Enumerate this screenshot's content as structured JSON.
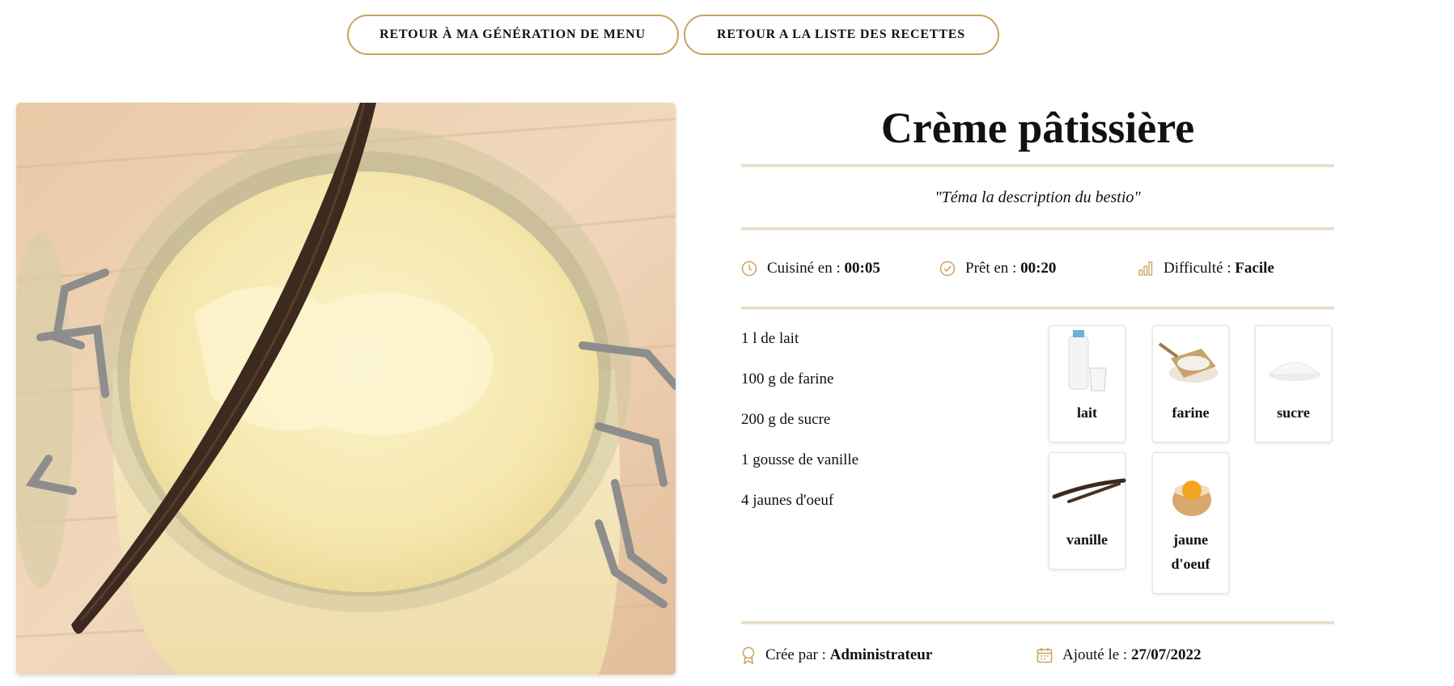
{
  "nav": {
    "back_to_menu": "RETOUR À MA GÉNÉRATION DE MENU",
    "back_to_list": "RETOUR A LA LISTE DES RECETTES"
  },
  "recipe": {
    "title": "Crème pâtissière",
    "description": "\"Téma la description du bestio\"",
    "cook_label": "Cuisiné en :",
    "cook_time": "00:05",
    "ready_label": "Prêt en :",
    "ready_time": "00:20",
    "difficulty_label": "Difficulté :",
    "difficulty": "Facile",
    "ingredients_text": [
      "1 l de lait",
      "100 g de farine",
      "200 g de sucre",
      "1 gousse de vanille",
      "4 jaunes d'oeuf"
    ],
    "ingredient_cards": [
      "lait",
      "farine",
      "sucre",
      "vanille",
      "jaune d'oeuf"
    ],
    "created_by_label": "Crée par :",
    "created_by": "Administrateur",
    "added_label": "Ajouté le :",
    "added_date": "27/07/2022"
  },
  "colors": {
    "accent": "#caa25e",
    "separator": "#e7ddc7"
  },
  "icons": [
    "clock-icon",
    "check-circle-icon",
    "signal-bars-icon",
    "award-icon",
    "calendar-icon"
  ]
}
